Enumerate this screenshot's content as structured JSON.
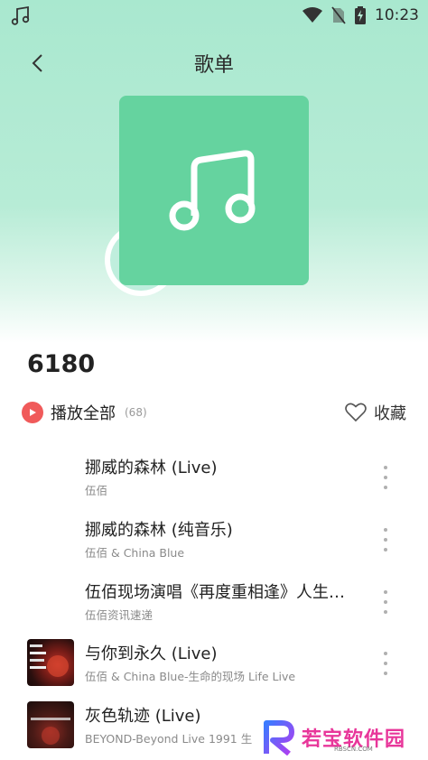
{
  "status_bar": {
    "time": "10:23"
  },
  "header": {
    "title": "歌单"
  },
  "playlist": {
    "name": "6180",
    "play_all_label": "播放全部",
    "count": "(68)",
    "favorite_label": "收藏"
  },
  "songs": [
    {
      "title": "挪威的森林 (Live)",
      "artist": "伍佰"
    },
    {
      "title": "挪威的森林 (纯音乐)",
      "artist": "伍佰 & China Blue"
    },
    {
      "title": "伍佰现场演唱《再度重相逢》人生…",
      "artist": "伍佰资讯速递"
    },
    {
      "title": "与你到永久 (Live)",
      "artist": "伍佰 & China Blue-生命的现场 Life Live"
    },
    {
      "title": "灰色轨迹 (Live)",
      "artist": "BEYOND-Beyond Live 1991 生"
    }
  ],
  "watermark": {
    "text": "若宝软件园",
    "sub": "RBSCN.COM"
  },
  "colors": {
    "cover": "#65d39f",
    "play_button": "#f05a5a",
    "header_gradient": "#a9e8cf"
  }
}
